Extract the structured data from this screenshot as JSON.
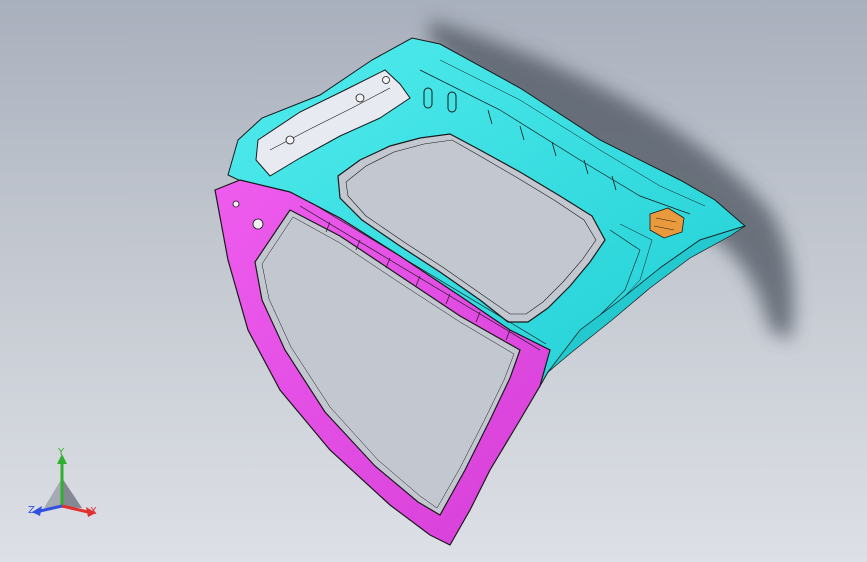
{
  "viewport": {
    "background_top": "#a9b0bd",
    "background_bottom": "#dde0e6"
  },
  "model": {
    "inner_panel_color": "#33e0e3",
    "outer_frame_color": "#e24de2",
    "bracket_color": "#e89a3c",
    "reinforcement_color": "#e8eaf2",
    "edge_color": "#1a1a1a",
    "shadow_color": "#5c6270"
  },
  "triad": {
    "x_label": "X",
    "y_label": "Y",
    "z_label": "Z",
    "x_color": "#e03030",
    "y_color": "#2fb02f",
    "z_color": "#3050e0"
  }
}
